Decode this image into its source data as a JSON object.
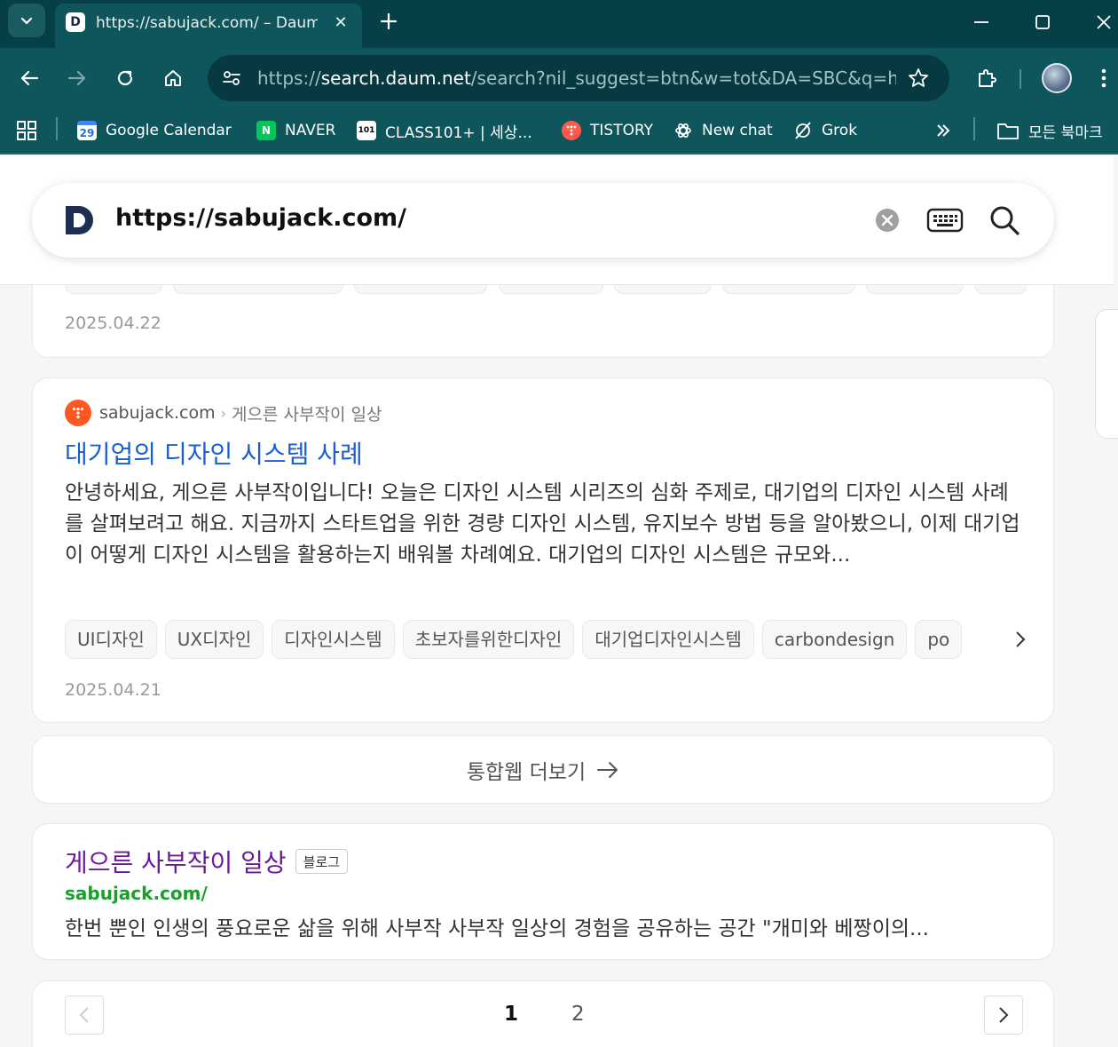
{
  "browser": {
    "tab_title": "https://sabujack.com/ – Daum",
    "tab_favicon": "D",
    "url_scheme": "https://",
    "url_host": "search.daum.net",
    "url_rest": "/search?nil_suggest=btn&w=tot&DA=SBC&q=htt...",
    "accent_color": "#0f555c"
  },
  "bookmarks": [
    {
      "label": "Google Calendar",
      "icon": "calendar-icon",
      "badge": "29"
    },
    {
      "label": "NAVER",
      "icon": "naver-icon",
      "badge": "N"
    },
    {
      "label": "CLASS101+ | 세상...",
      "icon": "class101-icon",
      "badge": "101"
    },
    {
      "label": "TISTORY",
      "icon": "tistory-icon",
      "badge": ""
    },
    {
      "label": "New chat",
      "icon": "openai-icon",
      "badge": ""
    },
    {
      "label": "Grok",
      "icon": "grok-icon",
      "badge": ""
    }
  ],
  "bookmarks_all_label": "모든 북마크",
  "search": {
    "query": "https://sabujack.com/"
  },
  "results": {
    "first_date": "2025.04.22",
    "second": {
      "site": "sabujack.com",
      "path": "게으른 사부작이 일상",
      "title": "대기업의 디자인 시스템 사례",
      "description": "안녕하세요, 게으른 사부작이입니다! 오늘은 디자인 시스템 시리즈의 심화 주제로, 대기업의 디자인 시스템 사례를 살펴보려고 해요. 지금까지 스타트업을 위한 경량 디자인 시스템, 유지보수 방법 등을 알아봤으니, 이제 대기업이 어떻게 디자인 시스템을 활용하는지 배워볼 차례예요. 대기업의 디자인 시스템은 규모와...",
      "tags": [
        "UI디자인",
        "UX디자인",
        "디자인시스템",
        "초보자를위한디자인",
        "대기업디자인시스템",
        "carbondesign",
        "po"
      ],
      "date": "2025.04.21"
    },
    "more_label": "통합웹 더보기",
    "blog": {
      "title": "게으른 사부작이 일상",
      "badge": "블로그",
      "url": "sabujack.com/",
      "description": "한번 뿐인 인생의 풍요로운 삶을 위해 사부작 사부작 일상의 경험을 공유하는 공간 \"개미와 베짱이의..."
    }
  },
  "pagination": {
    "pages": [
      "1",
      "2"
    ],
    "current": "1"
  }
}
